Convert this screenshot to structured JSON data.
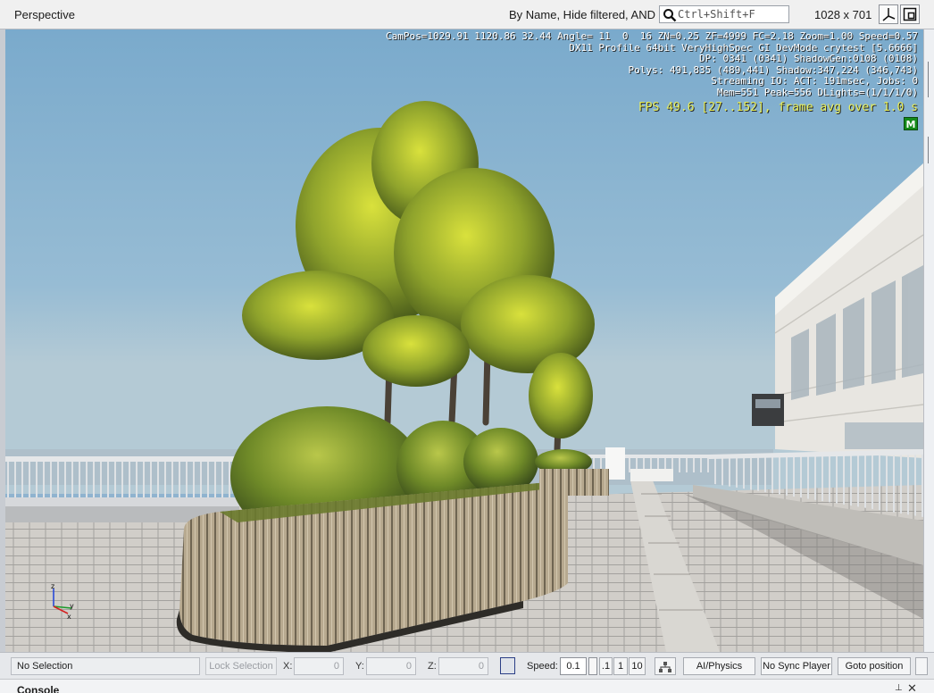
{
  "window": {
    "title": "Perspective",
    "filter_text": "By Name, Hide filtered, AND",
    "search_placeholder": "Ctrl+Shift+F",
    "resolution": "1028 x 701"
  },
  "viewport": {
    "stats_lines": [
      "CamPos=1029.91 1120.86 32.44 Angle= 11  0  16 ZN=0.25 ZF=4999 FC=2.18 Zoom=1.00 Speed=0.57",
      "DX11 Profile 64bit VeryHighSpec GI DevMode crytest [5.6666]",
      "DP: 0341 (0341) ShadowGen:0108 (0108)",
      "Polys: 491,835 (489,441) Shadow:347,224 (346,743)",
      "Streaming IO: ACT: 191msec, Jobs: 0",
      "Mem=551 Peak=556 DLights=(1/1/1/0)"
    ],
    "fps": "FPS 49.6 [27..152], frame avg over 1.0 s",
    "mode_badge": "M",
    "gizmo_axes": {
      "z": "z",
      "y": "y",
      "x": "x"
    }
  },
  "statusbar": {
    "selection": "No Selection",
    "lock_selection": "Lock Selection",
    "x_label": "X:",
    "x_value": "0",
    "y_label": "Y:",
    "y_value": "0",
    "z_label": "Z:",
    "z_value": "0",
    "speed_label": "Speed:",
    "speed_value": "0.1",
    "speed_presets": [
      ".1",
      "1",
      "10"
    ],
    "ai_physics": "AI/Physics",
    "no_sync_player": "No Sync Player",
    "goto_position": "Goto position"
  },
  "console": {
    "title": "Console",
    "pin_icon": "pin-icon",
    "close_icon": "close-icon"
  },
  "colors": {
    "fps_text": "#e8ef5a",
    "badge_green": "#148a1a",
    "sky_top": "#7faccc",
    "sky_horizon": "#b9ccd4"
  }
}
